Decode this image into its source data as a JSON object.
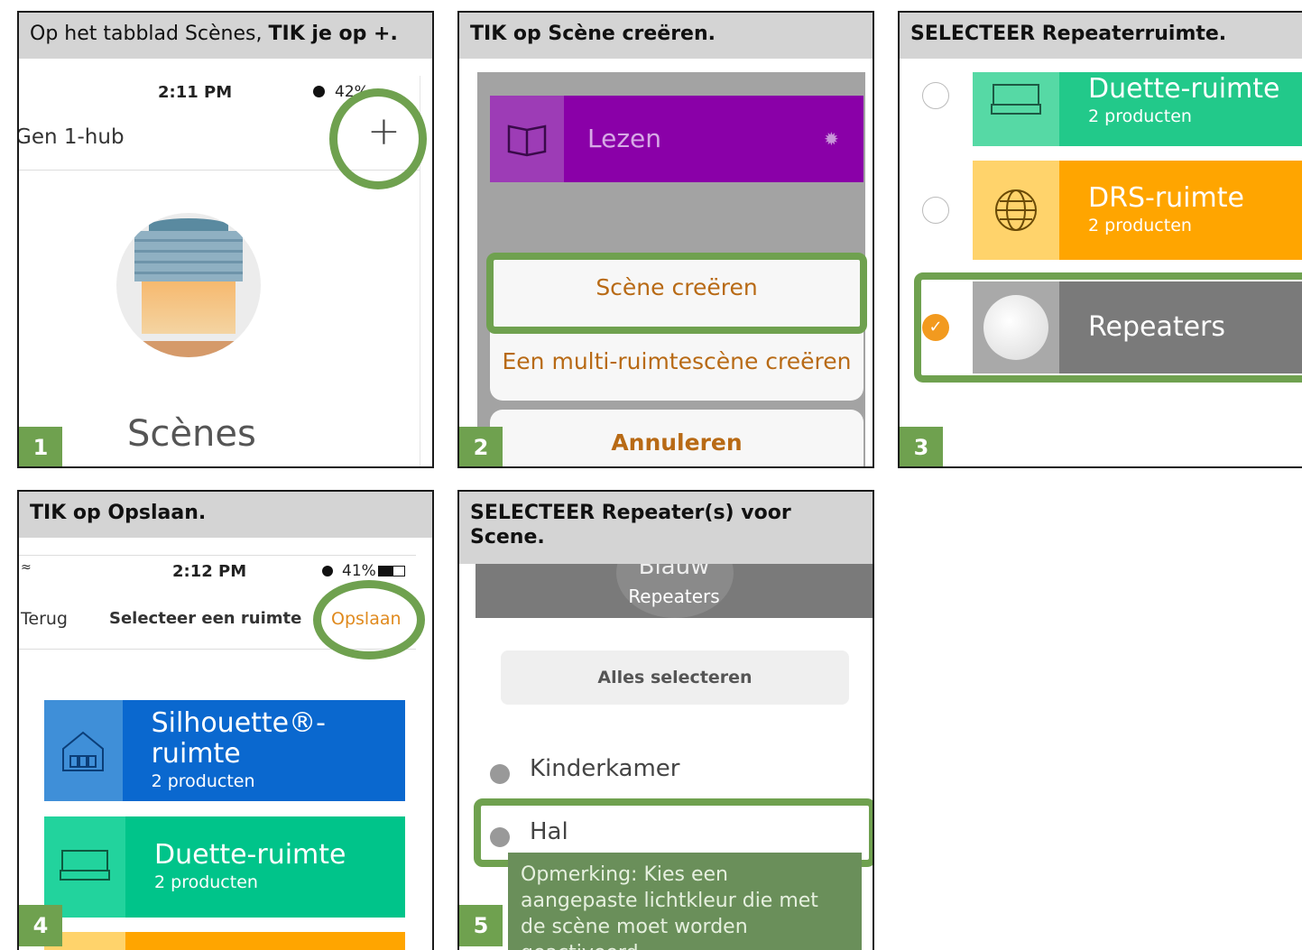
{
  "panels": {
    "p1": {
      "caption_plain": "Op het tabblad Scènes,",
      "caption_bold": "TIK je op +.",
      "step": "1",
      "status_time": "2:11 PM",
      "status_battery": "42%",
      "hub_label": "Gen 1-hub",
      "plus": "+",
      "scenes_title": "Scènes"
    },
    "p2": {
      "caption_bold": "TIK op Scène creëren.",
      "step": "2",
      "scene_name": "Lezen",
      "create_scene": "Scène creëren",
      "create_multi": "Een multi-ruimtescène creëren",
      "cancel": "Annuleren"
    },
    "p3": {
      "caption_bold": "SELECTEER Repeaterruimte.",
      "step": "3",
      "rooms": [
        {
          "name": "Duette-ruimte",
          "sub": "2 producten"
        },
        {
          "name": "DRS-ruimte",
          "sub": "2 producten"
        },
        {
          "name": "Repeaters",
          "sub": ""
        }
      ]
    },
    "p4": {
      "caption_bold": "TIK op Opslaan.",
      "step": "4",
      "status_time": "2:12 PM",
      "status_battery": "41%",
      "back": "Terug",
      "nav_title": "Selecteer een ruimte",
      "save": "Opslaan",
      "rooms": [
        {
          "name": "Silhouette®-ruimte",
          "sub": "2 producten"
        },
        {
          "name": "Duette-ruimte",
          "sub": "2 producten"
        }
      ]
    },
    "p5": {
      "caption_bold_line1": "SELECTEER Repeater(s) voor",
      "caption_bold_line2": "Scene.",
      "step": "5",
      "header_color": "Blauw",
      "header_room": "Repeaters",
      "select_all": "Alles selecteren",
      "items": [
        "Kinderkamer",
        "Hal"
      ],
      "note": "Opmerking: Kies een aangepaste lichtkleur die met de scène moet worden geactiveerd."
    }
  },
  "colors": {
    "accent_green": "#6fa14f",
    "caption_gray": "#d4d4d4",
    "orange": "#f29a1f",
    "purple": "#8a00a8",
    "blue": "#0a68cf",
    "teal_green": "#22c98a",
    "amber": "#ffa500"
  }
}
